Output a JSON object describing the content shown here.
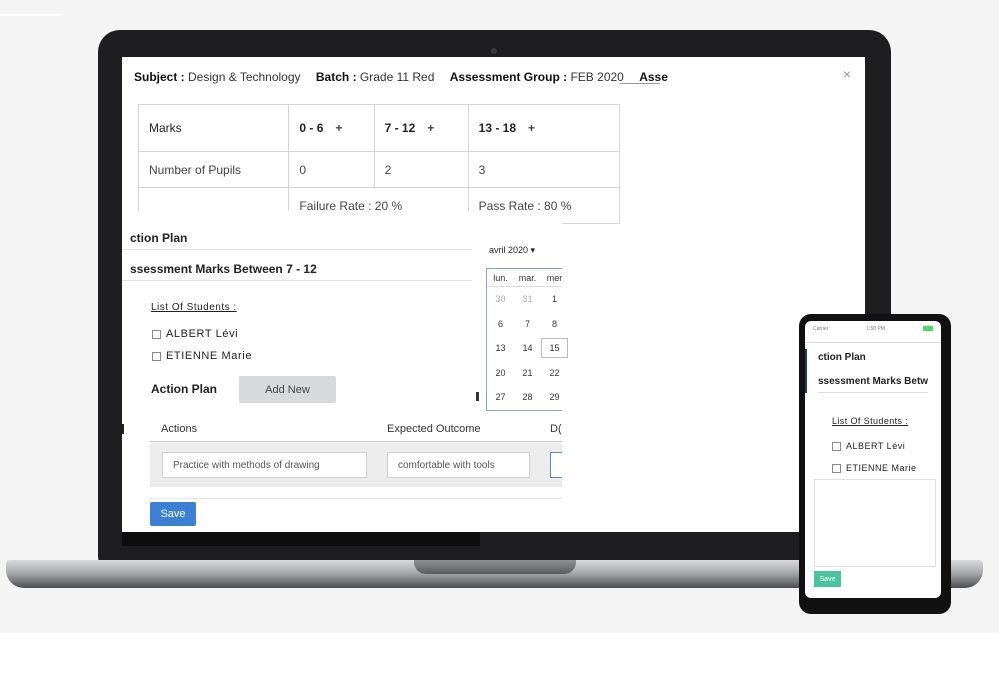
{
  "header": {
    "subject_label": "Subject :",
    "subject_value": "Design & Technology",
    "batch_label": "Batch :",
    "batch_value": "Grade 11 Red",
    "group_label": "Assessment Group :",
    "group_value": "FEB 2020",
    "truncated_label": "Asse",
    "close": "×"
  },
  "marks_table": {
    "row_marks_label": "Marks",
    "ranges": [
      "0 - 6",
      "7 - 12",
      "13 - 18"
    ],
    "plus": "+",
    "pupils_label": "Number of Pupils",
    "pupils": [
      "0",
      "2",
      "3"
    ],
    "failure_rate": "Failure Rate : 20 %",
    "pass_rate": "Pass Rate : 80 %"
  },
  "action_plan": {
    "title": "ction Plan",
    "subtitle": "ssessment Marks Between 7 - 12",
    "list_title": "List Of Students :",
    "students": [
      "ALBERT  Lévi",
      "ETIENNE  Marie"
    ],
    "action_plan_label": "Action Plan",
    "add_new": "Add New",
    "columns": [
      "Actions",
      "Expected Outcome",
      "D("
    ],
    "action_value": "Practice with methods of drawing",
    "outcome_value": "comfortable with tools",
    "save": "Save"
  },
  "calendar": {
    "month": "avril 2020 ▾",
    "weekdays": [
      "lun.",
      "mar.",
      "mer"
    ],
    "rows": [
      [
        "30",
        "31",
        "1"
      ],
      [
        "6",
        "7",
        "8"
      ],
      [
        "13",
        "14",
        "15"
      ],
      [
        "20",
        "21",
        "22"
      ],
      [
        "27",
        "28",
        "29"
      ]
    ],
    "muted": [
      "30",
      "31"
    ],
    "selected": "15"
  },
  "phone": {
    "carrier": "Carrier",
    "time": "1:50 PM",
    "title": "ction Plan",
    "subtitle": "ssessment Marks Betw",
    "list_title": "List Of Students :",
    "students": [
      "ALBERT  Lévi",
      "ETIENNE  Marie"
    ],
    "button": "Save"
  },
  "colors": {
    "save_button": "#3d7fd4",
    "add_button": "#d7d9db",
    "calendar_border": "#7ba7d9",
    "phone_button": "#4bc3a1"
  }
}
